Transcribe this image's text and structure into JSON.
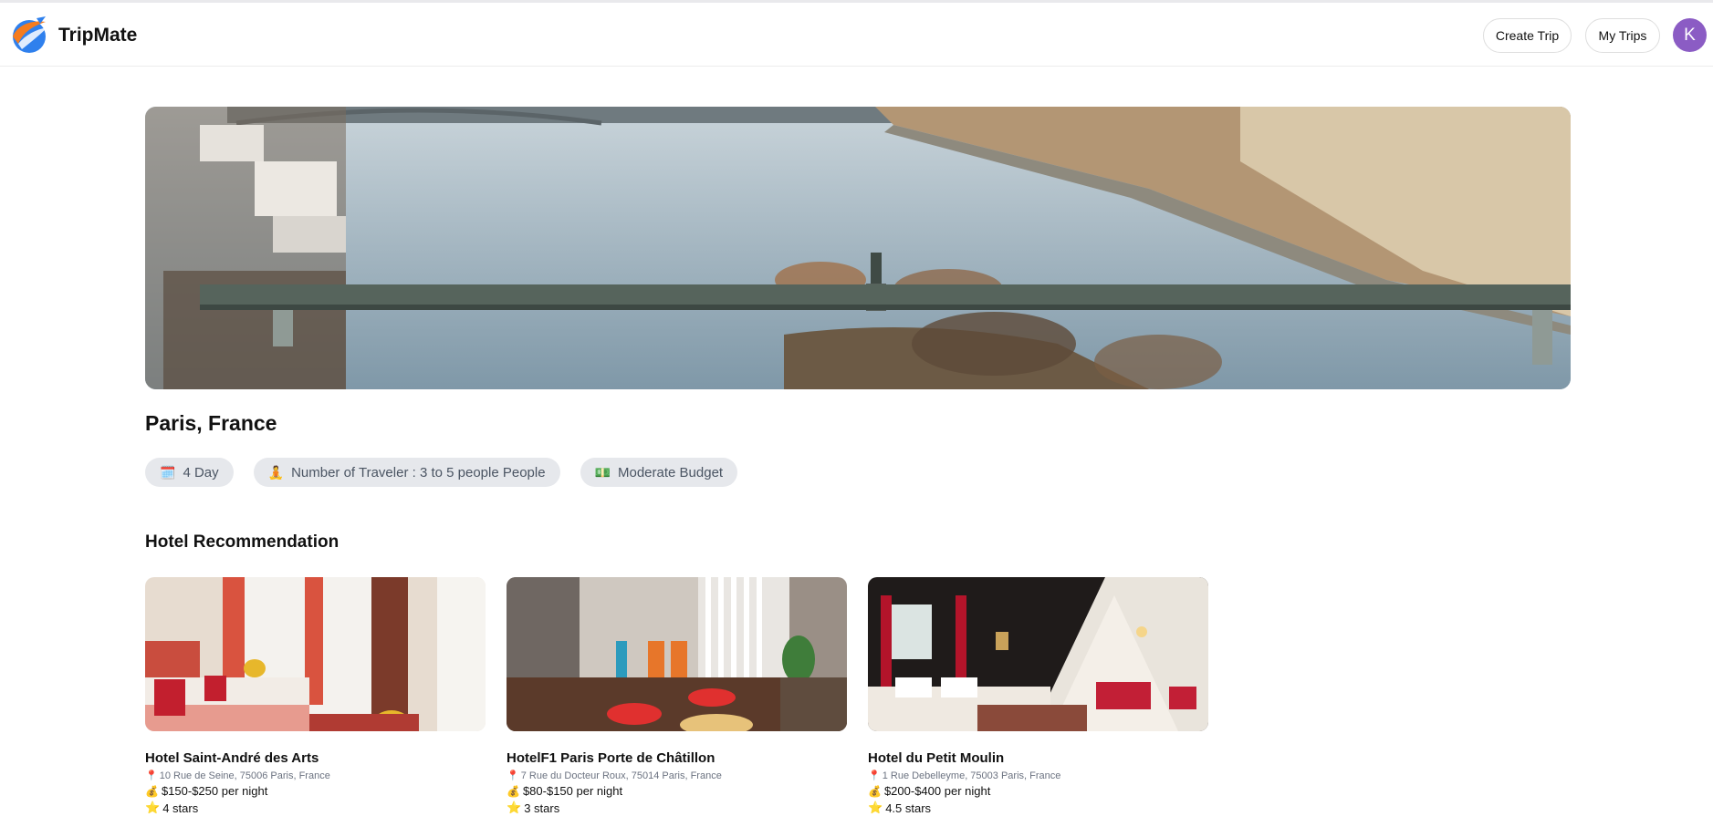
{
  "app": {
    "name": "TripMate",
    "accent": "#8b5cc4"
  },
  "header": {
    "create_trip_label": "Create Trip",
    "my_trips_label": "My Trips",
    "avatar_initial": "K"
  },
  "trip": {
    "destination": "Paris, France",
    "chips": [
      {
        "icon": "calendar-icon",
        "emoji": "🗓️",
        "label": "4 Day"
      },
      {
        "icon": "traveler-icon",
        "emoji": "🧘",
        "label": "Number of Traveler : 3 to 5 people People"
      },
      {
        "icon": "money-icon",
        "emoji": "💵",
        "label": "Moderate Budget"
      }
    ]
  },
  "hotels": {
    "section_title": "Hotel Recommendation",
    "items": [
      {
        "name": "Hotel Saint-André des Arts",
        "address": "10 Rue de Seine, 75006 Paris, France",
        "price": "$150-$250 per night",
        "rating": "4 stars"
      },
      {
        "name": "HotelF1 Paris Porte de Châtillon",
        "address": "7 Rue du Docteur Roux, 75014 Paris, France",
        "price": "$80-$150 per night",
        "rating": "3 stars"
      },
      {
        "name": "Hotel du Petit Moulin",
        "address": "1 Rue Debelleyme, 75003 Paris, France",
        "price": "$200-$400 per night",
        "rating": "4.5 stars"
      }
    ]
  }
}
